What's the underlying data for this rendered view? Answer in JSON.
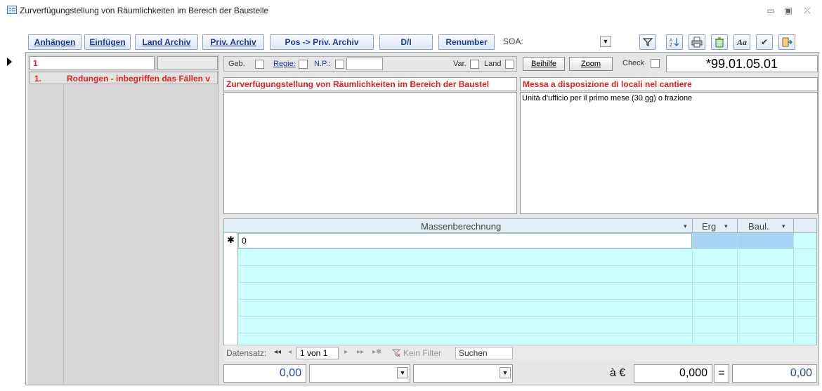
{
  "window": {
    "title": "Zurverfügungstellung von Räumlichkeiten im Bereich der Baustelle",
    "minimize_glyph": "▭",
    "restore_glyph": "▣",
    "close_glyph": "⤫"
  },
  "toolbar": {
    "attach_label": "Anhängen",
    "insert_label": "Einfügen",
    "land_archive_label": "Land Archiv",
    "priv_archive_label": "Priv. Archiv",
    "pos_to_priv_label": "Pos -> Priv. Archiv",
    "di_label": "D/I",
    "renumber_label": "Renumber",
    "soa_label": "SOA:",
    "soa_value": "",
    "italic_font_glyph": "Aa",
    "check_glyph": "✔"
  },
  "left": {
    "header_value": "1",
    "item_number": "1.",
    "item_text": "Rodungen - inbegriffen das Fällen v"
  },
  "header": {
    "geb_label": "Geb.",
    "regie_label": "Regie:",
    "np_label": "N.P.:",
    "np_value": "",
    "var_label": "Var.",
    "land_label": "Land",
    "beihilfe_label": "Beihilfe",
    "zoom_label": "Zoom",
    "check_label": "Check",
    "code_value": "*99.01.05.01"
  },
  "texts": {
    "title_de": "Zurverfügungstellung von Räumlichkeiten im Bereich der Baustel",
    "title_it": "Messa a disposizione di locali nel cantiere",
    "desc_de": "",
    "desc_it": "Unità d'ufficio per il primo mese (30 gg) o frazione"
  },
  "grid": {
    "columns": [
      "Massenberechnung",
      "Erg",
      "Baul."
    ],
    "new_row_marker": "✱",
    "new_row_value": "0"
  },
  "nav": {
    "record_label": "Datensatz:",
    "first_glyph": "◂◂",
    "prev_glyph": "◂",
    "record_value": "1 von 1",
    "next_glyph": "▸",
    "last_glyph": "▸▸",
    "new_glyph": "▸✱",
    "filter_label": "Kein Filter",
    "search_placeholder": "Suchen"
  },
  "footer": {
    "quantity_value": "0,00",
    "unit_label": "à €",
    "price_value": "0,000",
    "equals_label": "=",
    "total_value": "0,00"
  },
  "colors": {
    "accent_blue": "#1d3aa3",
    "red_text": "#e32020",
    "grid_bg": "#ccffff",
    "grid_header_bg": "#b7ddf8"
  }
}
